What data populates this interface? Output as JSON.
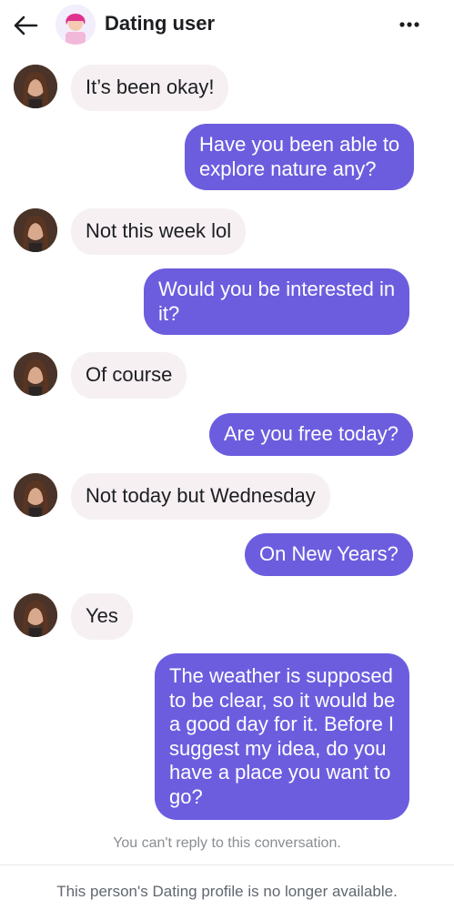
{
  "header": {
    "title": "Dating user",
    "back_icon": "arrow-left-icon",
    "more_icon": "more-horizontal-icon"
  },
  "messages": [
    {
      "direction": "incoming",
      "text": "It’s been okay!"
    },
    {
      "direction": "outgoing",
      "lines": [
        "Have you been able to",
        "explore nature any?"
      ]
    },
    {
      "direction": "incoming",
      "text": "Not this week lol"
    },
    {
      "direction": "outgoing",
      "lines": [
        "Would you be interested in",
        "it?"
      ]
    },
    {
      "direction": "incoming",
      "text": "Of course"
    },
    {
      "direction": "outgoing",
      "text": "Are you free today?"
    },
    {
      "direction": "incoming",
      "text": "Not today but Wednesday"
    },
    {
      "direction": "outgoing",
      "text": "On New Years?"
    },
    {
      "direction": "incoming",
      "text": "Yes"
    },
    {
      "direction": "outgoing",
      "lines": [
        "The weather is supposed",
        "to be clear, so it would be",
        "a good day for it. Before I",
        "suggest my idea, do you",
        "have a place you want to",
        "go?"
      ]
    }
  ],
  "footer": {
    "cannot_reply": "You can't reply to this conversation.",
    "profile_unavailable": "This person's Dating profile is no longer available."
  },
  "colors": {
    "outgoing_bubble": "#6c5ddf",
    "incoming_bubble": "#f6f0f3"
  }
}
